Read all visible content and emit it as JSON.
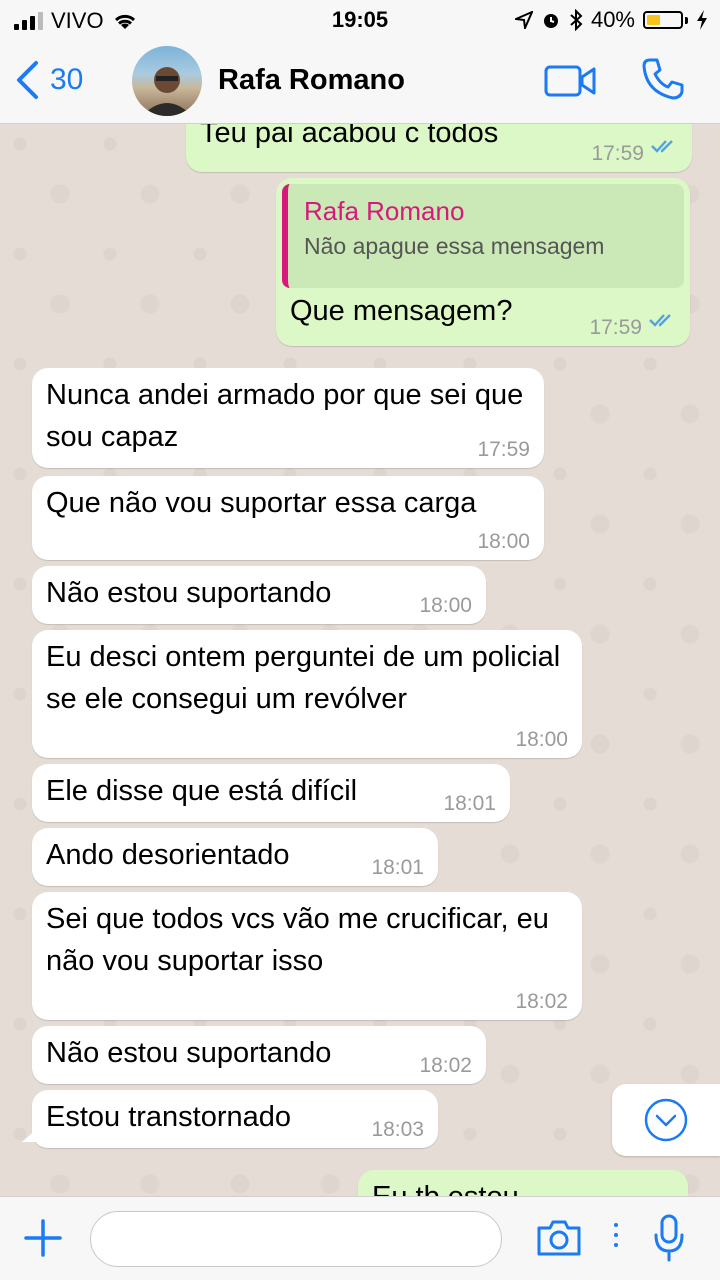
{
  "status_bar": {
    "carrier": "VIVO",
    "time": "19:05",
    "battery": "40%",
    "battery_level": 0.4
  },
  "header": {
    "back_count": "30",
    "contact_name": "Rafa Romano"
  },
  "messages": [
    {
      "text": "Teu pai acabou c todos",
      "time": "17:59",
      "direction": "out",
      "status": "read"
    },
    {
      "reply_to_name": "Rafa Romano",
      "reply_to_text": "Não apague essa mensagem",
      "text": "Que mensagem?",
      "time": "17:59",
      "direction": "out",
      "status": "read"
    },
    {
      "text": "Nunca andei armado por que sei que sou capaz",
      "time": "17:59",
      "direction": "in"
    },
    {
      "text": "Que não vou suportar essa carga",
      "time": "18:00",
      "direction": "in"
    },
    {
      "text": "Não estou suportando",
      "time": "18:00",
      "direction": "in"
    },
    {
      "text": "Eu desci ontem perguntei de um policial se ele consegui um revólver",
      "time": "18:00",
      "direction": "in"
    },
    {
      "text": "Ele disse que está difícil",
      "time": "18:01",
      "direction": "in"
    },
    {
      "text": "Ando desorientado",
      "time": "18:01",
      "direction": "in"
    },
    {
      "text": "Sei que todos vcs vão me crucificar, eu não vou suportar isso",
      "time": "18:02",
      "direction": "in"
    },
    {
      "text": "Não estou suportando",
      "time": "18:02",
      "direction": "in"
    },
    {
      "text": "Estou transtornado",
      "time": "18:03",
      "direction": "in"
    },
    {
      "text": "Eu tb estou",
      "direction": "out"
    }
  ],
  "input": {
    "placeholder": ""
  },
  "icons": {
    "back": "chevron-left-icon",
    "video": "video-camera-icon",
    "call": "phone-icon",
    "scroll": "chevron-down-circle-icon",
    "plus": "plus-icon",
    "camera": "camera-icon",
    "more": "vertical-dots-icon",
    "mic": "microphone-icon",
    "read": "double-check-icon"
  },
  "colors": {
    "accent": "#1a7bf2",
    "outgoing": "#dcf8c6",
    "incoming": "#ffffff",
    "reply_bar": "#d6197b",
    "battery": "#f6c31c"
  }
}
